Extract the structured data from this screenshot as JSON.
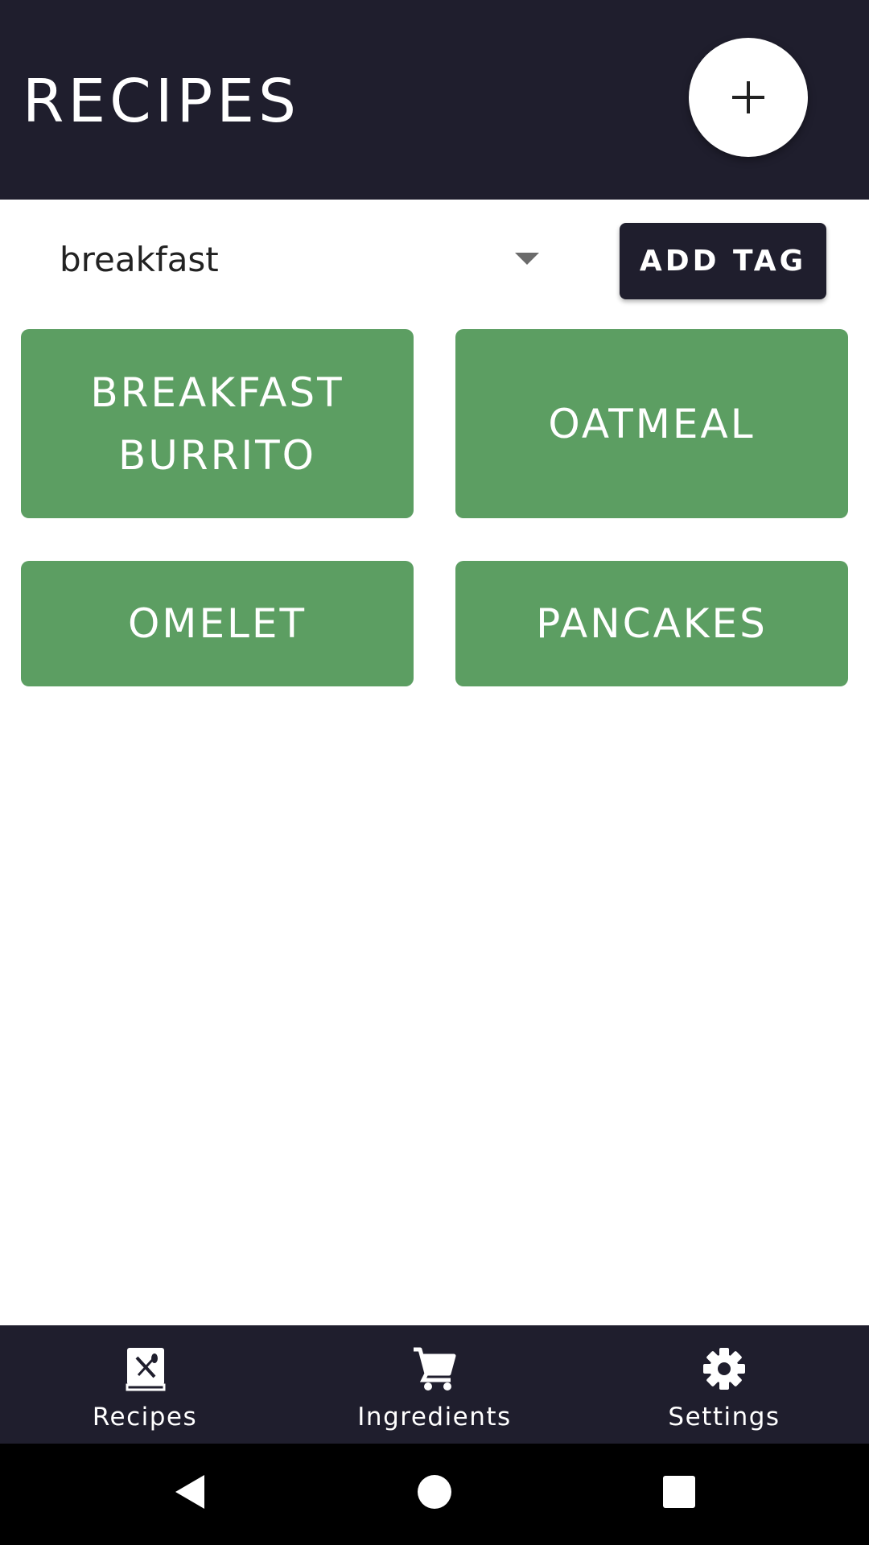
{
  "header": {
    "title": "RECIPES",
    "add_icon": "plus-icon"
  },
  "filter": {
    "selected_tag": "breakfast",
    "add_tag_label": "ADD TAG"
  },
  "recipes": [
    {
      "label": "BREAKFAST BURRITO"
    },
    {
      "label": "OATMEAL"
    },
    {
      "label": "OMELET"
    },
    {
      "label": "PANCAKES"
    }
  ],
  "bottom_nav": {
    "items": [
      {
        "label": "Recipes",
        "icon": "recipe-book-icon"
      },
      {
        "label": "Ingredients",
        "icon": "shopping-cart-icon"
      },
      {
        "label": "Settings",
        "icon": "gear-icon"
      }
    ]
  },
  "system_nav": {
    "back": "back-icon",
    "home": "home-icon",
    "recents": "recents-icon"
  },
  "colors": {
    "app_bar": "#1f1e2d",
    "card": "#5c9e62",
    "background": "#ffffff"
  }
}
